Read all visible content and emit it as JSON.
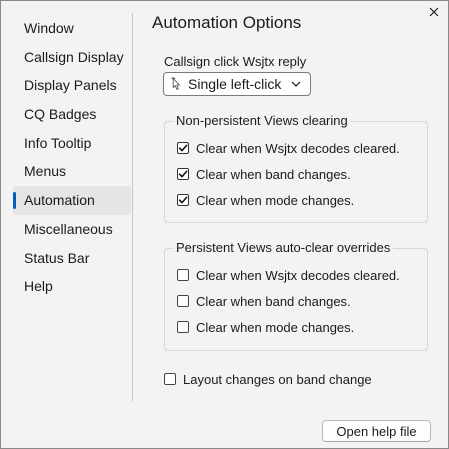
{
  "window": {
    "close_icon": "close-icon"
  },
  "sidebar": {
    "items": [
      {
        "label": "Window"
      },
      {
        "label": "Callsign Display"
      },
      {
        "label": "Display Panels"
      },
      {
        "label": "CQ Badges"
      },
      {
        "label": "Info Tooltip"
      },
      {
        "label": "Menus"
      },
      {
        "label": "Automation",
        "selected": true
      },
      {
        "label": "Miscellaneous"
      },
      {
        "label": "Status Bar"
      },
      {
        "label": "Help"
      }
    ],
    "accent_color": "#005fb8"
  },
  "main": {
    "title": "Automation Options",
    "reply": {
      "label": "Callsign click Wsjtx reply",
      "selected": "Single left-click",
      "icon": "pointer-cursor-icon"
    },
    "non_persistent": {
      "title": "Non-persistent Views clearing",
      "options": [
        {
          "label": "Clear when Wsjtx decodes cleared.",
          "checked": true
        },
        {
          "label": "Clear when band changes.",
          "checked": true
        },
        {
          "label": "Clear when mode changes.",
          "checked": true
        }
      ]
    },
    "persistent": {
      "title": "Persistent Views auto-clear overrides",
      "options": [
        {
          "label": "Clear when Wsjtx decodes cleared.",
          "checked": false
        },
        {
          "label": "Clear when band changes.",
          "checked": false
        },
        {
          "label": "Clear when mode changes.",
          "checked": false
        }
      ]
    },
    "layout_changes": {
      "label": "Layout changes on band change",
      "checked": false
    },
    "help_button": "Open help file"
  }
}
